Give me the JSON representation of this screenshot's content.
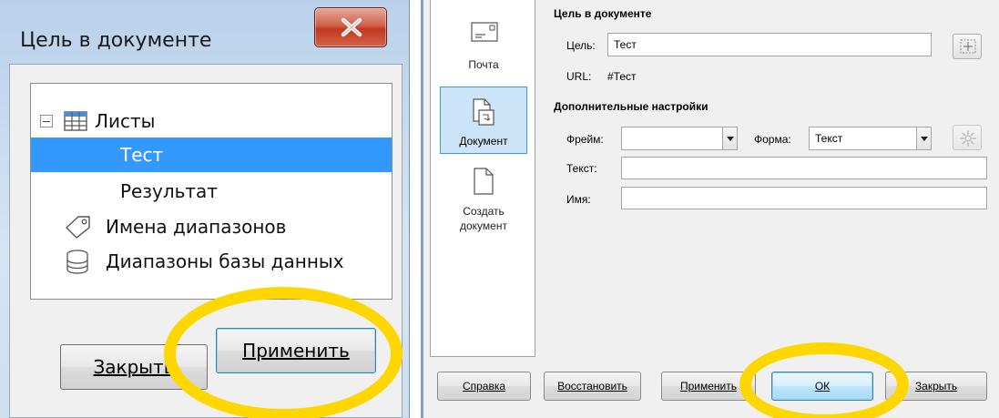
{
  "left_dialog": {
    "title": "Цель в документе",
    "tree": {
      "items": [
        {
          "label": "Листы",
          "icon": "sheets-grid-icon"
        },
        {
          "label": "Тест",
          "selected": true
        },
        {
          "label": "Результат"
        },
        {
          "label": "Имена диапазонов",
          "icon": "tag-icon"
        },
        {
          "label": "Диапазоны базы данных",
          "icon": "database-icon"
        }
      ]
    },
    "buttons": {
      "close": "Закрыть",
      "apply": "Применить"
    }
  },
  "right_dialog": {
    "sidebar": {
      "mail": "Почта",
      "document": "Документ",
      "new_document_line1": "Создать",
      "new_document_line2": "документ"
    },
    "target_section": {
      "title": "Цель в документе",
      "target_label": "Цель:",
      "target_value": "Тест",
      "url_label": "URL:",
      "url_value": "#Тест"
    },
    "advanced_section": {
      "title": "Дополнительные настройки",
      "frame_label": "Фрейм:",
      "frame_value": "",
      "form_label": "Форма:",
      "form_value": "Текст",
      "text_label": "Текст:",
      "text_value": "",
      "name_label": "Имя:",
      "name_value": ""
    },
    "buttons": {
      "help": "Справка",
      "reset": "Восстановить",
      "apply": "Применить",
      "ok": "ОК",
      "close": "Закрыть"
    }
  },
  "colors": {
    "selection": "#3399ff",
    "highlight": "#ffd700",
    "close_button": "#c1391f"
  }
}
